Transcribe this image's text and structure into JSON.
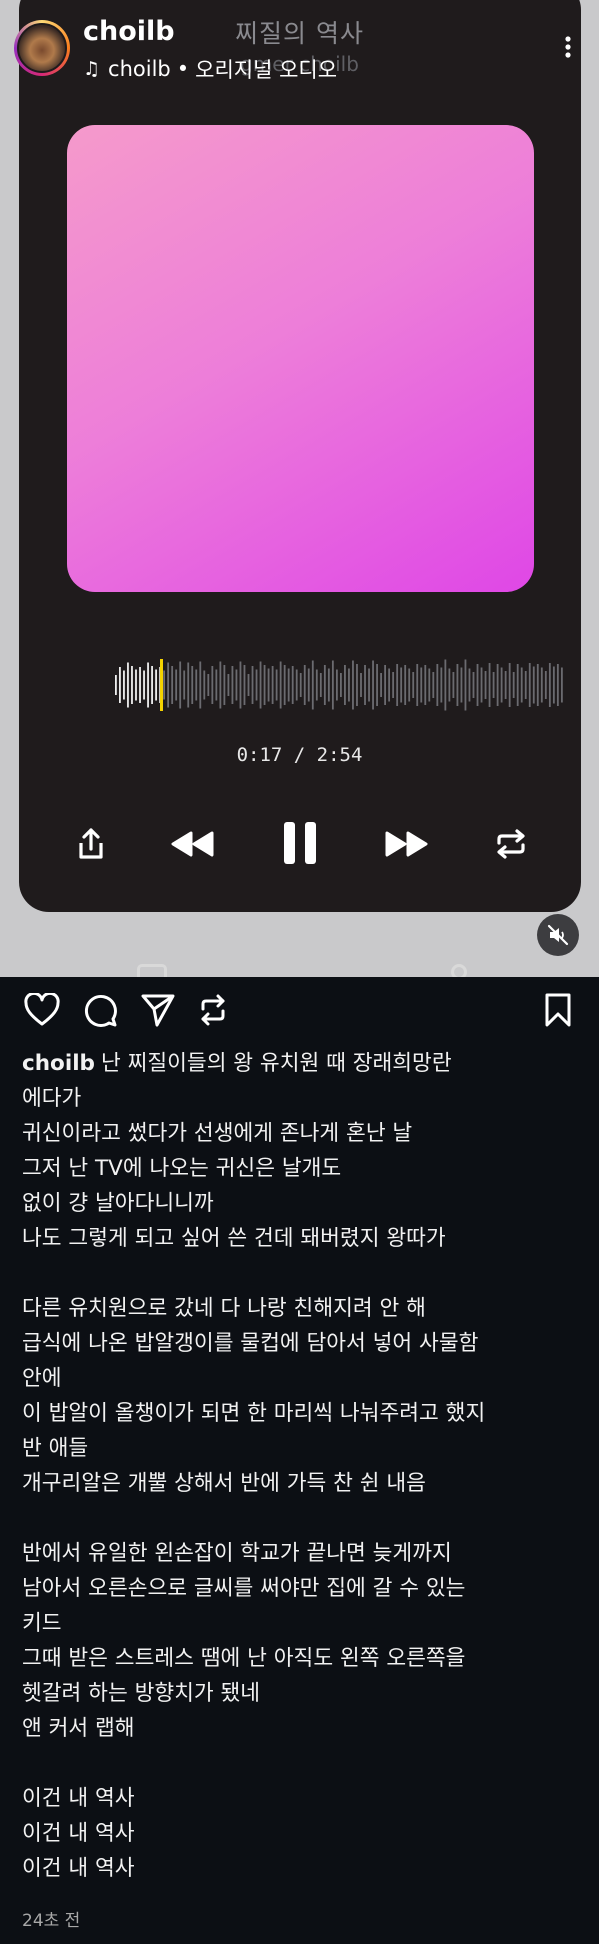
{
  "header": {
    "username": "choilb",
    "sub_author": "choilb",
    "sub_separator": "•",
    "sub_type": "오리지널 오디오",
    "more_icon": "more-vertical-icon"
  },
  "player": {
    "song_title": "찌질의 역사",
    "ghost_sub": "gmer choilb",
    "elapsed": "0:17",
    "total": "2:54",
    "time_display": "0:17 / 2:54",
    "progress": 0.1,
    "album_gradient": [
      "#f59acb",
      "#ed7ed9",
      "#df47e6"
    ],
    "controls": [
      "share-icon",
      "rewind-icon",
      "pause-icon",
      "fast-forward-icon",
      "repeat-icon"
    ],
    "accent": "#f5d300"
  },
  "actions": [
    "heart-icon",
    "comment-icon",
    "send-icon",
    "remix-icon",
    "bookmark-icon"
  ],
  "caption": {
    "username": "choilb",
    "lines": [
      "난 찌질이들의 왕 유치원 때 장래희망란",
      "에다가",
      "귀신이라고 썼다가 선생에게 존나게 혼난 날",
      "그저 난 TV에 나오는 귀신은 날개도",
      "없이 걍 날아다니니까",
      "나도 그렇게 되고 싶어 쓴 건데 돼버렸지 왕따가",
      "",
      "다른 유치원으로 갔네 다 나랑 친해지려 안 해",
      "급식에 나온 밥알갱이를 물컵에 담아서 넣어 사물함",
      "안에",
      "이 밥알이 올챙이가 되면 한 마리씩 나눠주려고 했지",
      "반 애들",
      "개구리알은 개뿔 상해서 반에 가득 찬 쉰 내음",
      "",
      "반에서 유일한 왼손잡이 학교가 끝나면 늦게까지",
      "남아서 오른손으로 글씨를 써야만 집에 갈 수 있는",
      "키드",
      "그때 받은 스트레스 땜에 난 아직도 왼쪽 오른쪽을",
      "헷갈려 하는 방향치가 됐네",
      "앤 커서 랩해",
      "",
      "이건 내 역사",
      "이건 내 역사",
      "이건 내 역사"
    ]
  },
  "timestamp": "24초 전"
}
